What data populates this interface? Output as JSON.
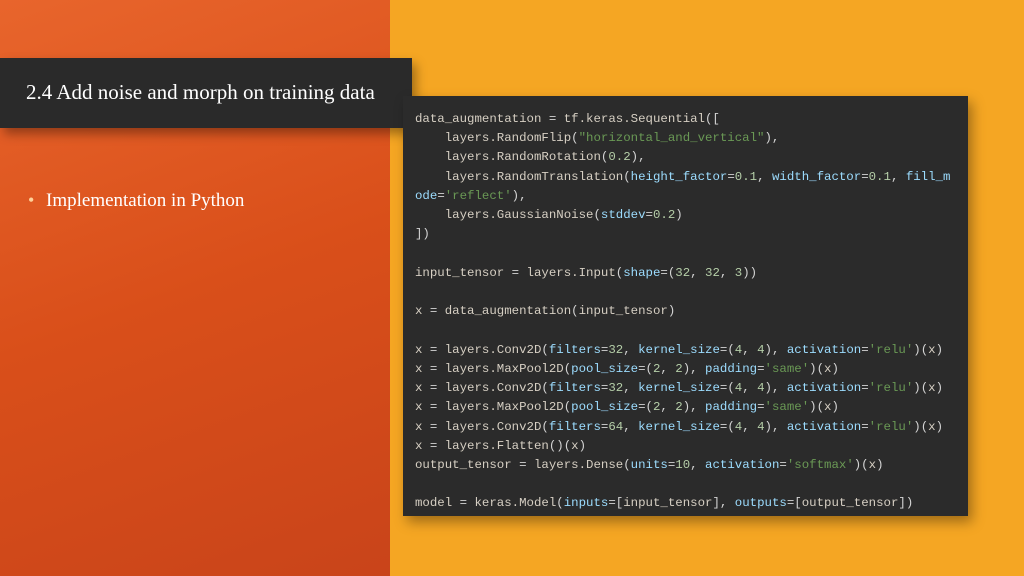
{
  "title": "2.4 Add noise and morph on training data",
  "bullets": [
    "Implementation in Python"
  ],
  "code_lines": [
    [
      [
        "kw",
        "data_augmentation "
      ],
      [
        "op",
        "= "
      ],
      [
        "kw",
        "tf.keras.Sequential"
      ],
      [
        "punc",
        "(["
      ]
    ],
    [
      [
        "kw",
        "    layers.RandomFlip"
      ],
      [
        "punc",
        "("
      ],
      [
        "str",
        "\"horizontal_and_vertical\""
      ],
      [
        "punc",
        "),"
      ]
    ],
    [
      [
        "kw",
        "    layers.RandomRotation"
      ],
      [
        "punc",
        "("
      ],
      [
        "num",
        "0.2"
      ],
      [
        "punc",
        "),"
      ]
    ],
    [
      [
        "kw",
        "    layers.RandomTranslation"
      ],
      [
        "punc",
        "("
      ],
      [
        "arg",
        "height_factor"
      ],
      [
        "op",
        "="
      ],
      [
        "num",
        "0.1"
      ],
      [
        "punc",
        ", "
      ],
      [
        "arg",
        "width_factor"
      ],
      [
        "op",
        "="
      ],
      [
        "num",
        "0.1"
      ],
      [
        "punc",
        ", "
      ],
      [
        "arg",
        "fill_mode"
      ],
      [
        "op",
        "="
      ],
      [
        "str",
        "'reflect'"
      ],
      [
        "punc",
        "),"
      ]
    ],
    [
      [
        "kw",
        "    layers.GaussianNoise"
      ],
      [
        "punc",
        "("
      ],
      [
        "arg",
        "stddev"
      ],
      [
        "op",
        "="
      ],
      [
        "num",
        "0.2"
      ],
      [
        "punc",
        ")"
      ]
    ],
    [
      [
        "punc",
        "])"
      ]
    ],
    [
      [
        "kw",
        ""
      ]
    ],
    [
      [
        "kw",
        "input_tensor "
      ],
      [
        "op",
        "= "
      ],
      [
        "kw",
        "layers.Input"
      ],
      [
        "punc",
        "("
      ],
      [
        "arg",
        "shape"
      ],
      [
        "op",
        "="
      ],
      [
        "punc",
        "("
      ],
      [
        "num",
        "32"
      ],
      [
        "punc",
        ", "
      ],
      [
        "num",
        "32"
      ],
      [
        "punc",
        ", "
      ],
      [
        "num",
        "3"
      ],
      [
        "punc",
        "))"
      ]
    ],
    [
      [
        "kw",
        ""
      ]
    ],
    [
      [
        "kw",
        "x "
      ],
      [
        "op",
        "= "
      ],
      [
        "kw",
        "data_augmentation"
      ],
      [
        "punc",
        "("
      ],
      [
        "kw",
        "input_tensor"
      ],
      [
        "punc",
        ")"
      ]
    ],
    [
      [
        "kw",
        ""
      ]
    ],
    [
      [
        "kw",
        "x "
      ],
      [
        "op",
        "= "
      ],
      [
        "kw",
        "layers.Conv2D"
      ],
      [
        "punc",
        "("
      ],
      [
        "arg",
        "filters"
      ],
      [
        "op",
        "="
      ],
      [
        "num",
        "32"
      ],
      [
        "punc",
        ", "
      ],
      [
        "arg",
        "kernel_size"
      ],
      [
        "op",
        "="
      ],
      [
        "punc",
        "("
      ],
      [
        "num",
        "4"
      ],
      [
        "punc",
        ", "
      ],
      [
        "num",
        "4"
      ],
      [
        "punc",
        "), "
      ],
      [
        "arg",
        "activation"
      ],
      [
        "op",
        "="
      ],
      [
        "str",
        "'relu'"
      ],
      [
        "punc",
        ")("
      ],
      [
        "kw",
        "x"
      ],
      [
        "punc",
        ")"
      ]
    ],
    [
      [
        "kw",
        "x "
      ],
      [
        "op",
        "= "
      ],
      [
        "kw",
        "layers.MaxPool2D"
      ],
      [
        "punc",
        "("
      ],
      [
        "arg",
        "pool_size"
      ],
      [
        "op",
        "="
      ],
      [
        "punc",
        "("
      ],
      [
        "num",
        "2"
      ],
      [
        "punc",
        ", "
      ],
      [
        "num",
        "2"
      ],
      [
        "punc",
        "), "
      ],
      [
        "arg",
        "padding"
      ],
      [
        "op",
        "="
      ],
      [
        "str",
        "'same'"
      ],
      [
        "punc",
        ")("
      ],
      [
        "kw",
        "x"
      ],
      [
        "punc",
        ")"
      ]
    ],
    [
      [
        "kw",
        "x "
      ],
      [
        "op",
        "= "
      ],
      [
        "kw",
        "layers.Conv2D"
      ],
      [
        "punc",
        "("
      ],
      [
        "arg",
        "filters"
      ],
      [
        "op",
        "="
      ],
      [
        "num",
        "32"
      ],
      [
        "punc",
        ", "
      ],
      [
        "arg",
        "kernel_size"
      ],
      [
        "op",
        "="
      ],
      [
        "punc",
        "("
      ],
      [
        "num",
        "4"
      ],
      [
        "punc",
        ", "
      ],
      [
        "num",
        "4"
      ],
      [
        "punc",
        "), "
      ],
      [
        "arg",
        "activation"
      ],
      [
        "op",
        "="
      ],
      [
        "str",
        "'relu'"
      ],
      [
        "punc",
        ")("
      ],
      [
        "kw",
        "x"
      ],
      [
        "punc",
        ")"
      ]
    ],
    [
      [
        "kw",
        "x "
      ],
      [
        "op",
        "= "
      ],
      [
        "kw",
        "layers.MaxPool2D"
      ],
      [
        "punc",
        "("
      ],
      [
        "arg",
        "pool_size"
      ],
      [
        "op",
        "="
      ],
      [
        "punc",
        "("
      ],
      [
        "num",
        "2"
      ],
      [
        "punc",
        ", "
      ],
      [
        "num",
        "2"
      ],
      [
        "punc",
        "), "
      ],
      [
        "arg",
        "padding"
      ],
      [
        "op",
        "="
      ],
      [
        "str",
        "'same'"
      ],
      [
        "punc",
        ")("
      ],
      [
        "kw",
        "x"
      ],
      [
        "punc",
        ")"
      ]
    ],
    [
      [
        "kw",
        "x "
      ],
      [
        "op",
        "= "
      ],
      [
        "kw",
        "layers.Conv2D"
      ],
      [
        "punc",
        "("
      ],
      [
        "arg",
        "filters"
      ],
      [
        "op",
        "="
      ],
      [
        "num",
        "64"
      ],
      [
        "punc",
        ", "
      ],
      [
        "arg",
        "kernel_size"
      ],
      [
        "op",
        "="
      ],
      [
        "punc",
        "("
      ],
      [
        "num",
        "4"
      ],
      [
        "punc",
        ", "
      ],
      [
        "num",
        "4"
      ],
      [
        "punc",
        "), "
      ],
      [
        "arg",
        "activation"
      ],
      [
        "op",
        "="
      ],
      [
        "str",
        "'relu'"
      ],
      [
        "punc",
        ")("
      ],
      [
        "kw",
        "x"
      ],
      [
        "punc",
        ")"
      ]
    ],
    [
      [
        "kw",
        "x "
      ],
      [
        "op",
        "= "
      ],
      [
        "kw",
        "layers.Flatten"
      ],
      [
        "punc",
        "()("
      ],
      [
        "kw",
        "x"
      ],
      [
        "punc",
        ")"
      ]
    ],
    [
      [
        "kw",
        "output_tensor "
      ],
      [
        "op",
        "= "
      ],
      [
        "kw",
        "layers.Dense"
      ],
      [
        "punc",
        "("
      ],
      [
        "arg",
        "units"
      ],
      [
        "op",
        "="
      ],
      [
        "num",
        "10"
      ],
      [
        "punc",
        ", "
      ],
      [
        "arg",
        "activation"
      ],
      [
        "op",
        "="
      ],
      [
        "str",
        "'softmax'"
      ],
      [
        "punc",
        ")("
      ],
      [
        "kw",
        "x"
      ],
      [
        "punc",
        ")"
      ]
    ],
    [
      [
        "kw",
        ""
      ]
    ],
    [
      [
        "kw",
        "model "
      ],
      [
        "op",
        "= "
      ],
      [
        "kw",
        "keras.Model"
      ],
      [
        "punc",
        "("
      ],
      [
        "arg",
        "inputs"
      ],
      [
        "op",
        "="
      ],
      [
        "punc",
        "["
      ],
      [
        "kw",
        "input_tensor"
      ],
      [
        "punc",
        "], "
      ],
      [
        "arg",
        "outputs"
      ],
      [
        "op",
        "="
      ],
      [
        "punc",
        "["
      ],
      [
        "kw",
        "output_tensor"
      ],
      [
        "punc",
        "])"
      ]
    ]
  ]
}
